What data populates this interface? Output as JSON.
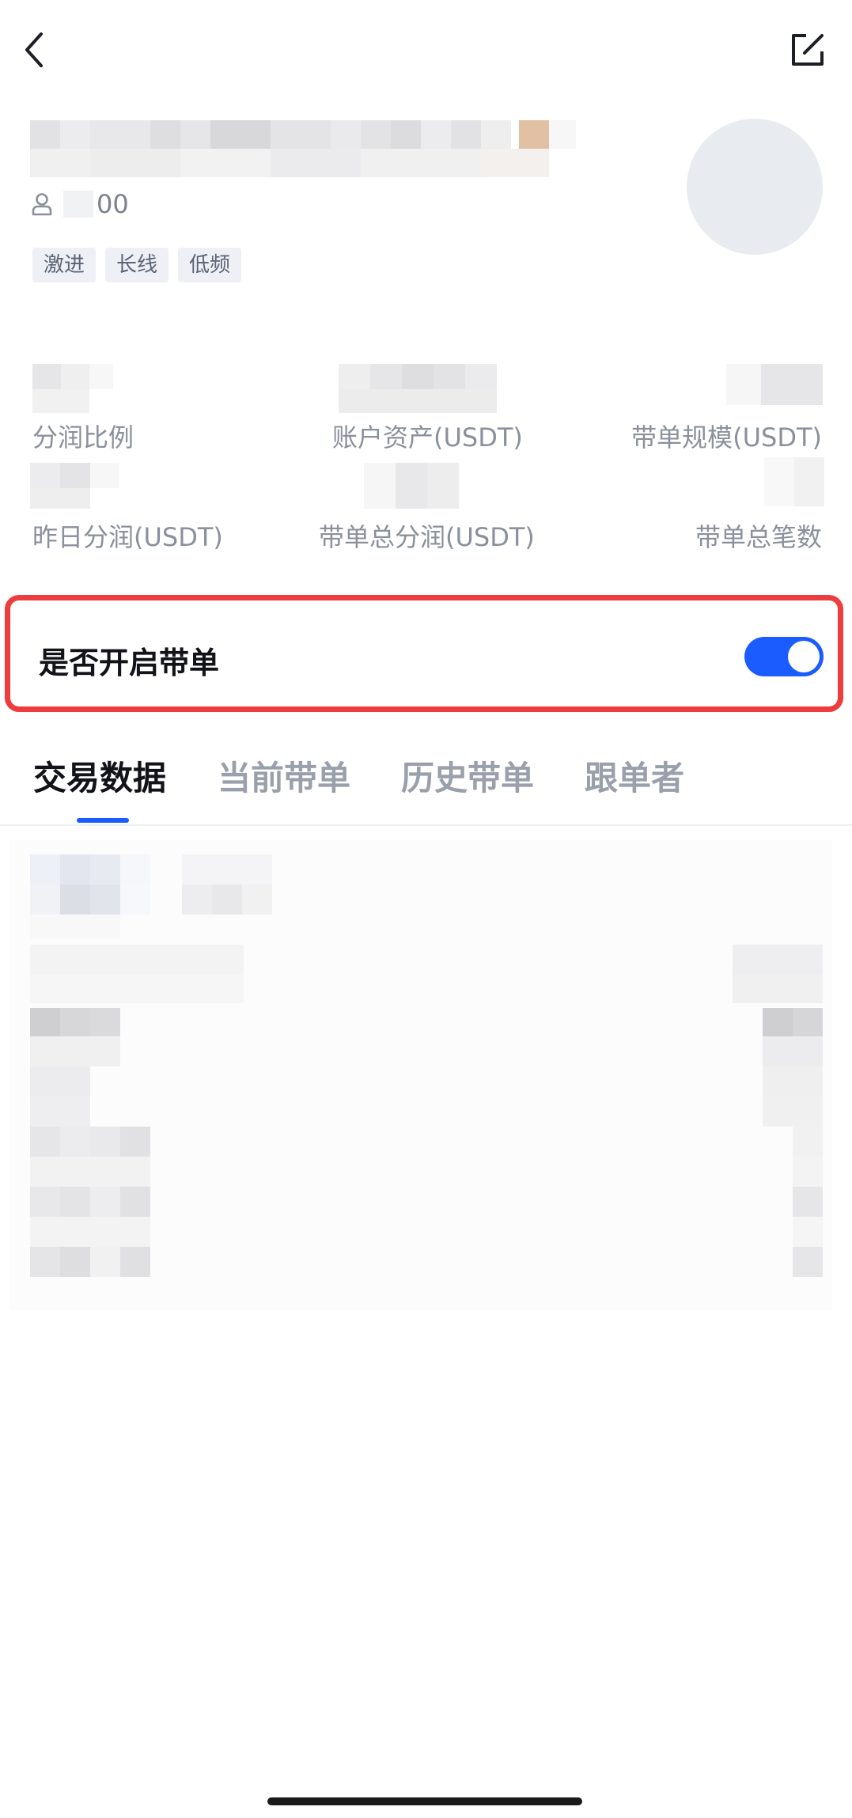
{
  "header": {
    "uid_suffix": "00",
    "tags": [
      "激进",
      "长线",
      "低频"
    ]
  },
  "stats": {
    "row1": [
      "分润比例",
      "账户资产(USDT)",
      "带单规模(USDT)"
    ],
    "row2": [
      "昨日分润(USDT)",
      "带单总分润(USDT)",
      "带单总笔数"
    ]
  },
  "toggle": {
    "label": "是否开启带单",
    "enabled": true
  },
  "tabs": {
    "items": [
      "交易数据",
      "当前带单",
      "历史带单",
      "跟单者"
    ],
    "active_index": 0
  },
  "colors": {
    "accent": "#1a5cff",
    "highlight_border": "#ef3d3f"
  },
  "icons": {
    "back": "chevron-left-icon",
    "edit": "edit-icon",
    "user": "user-icon"
  }
}
